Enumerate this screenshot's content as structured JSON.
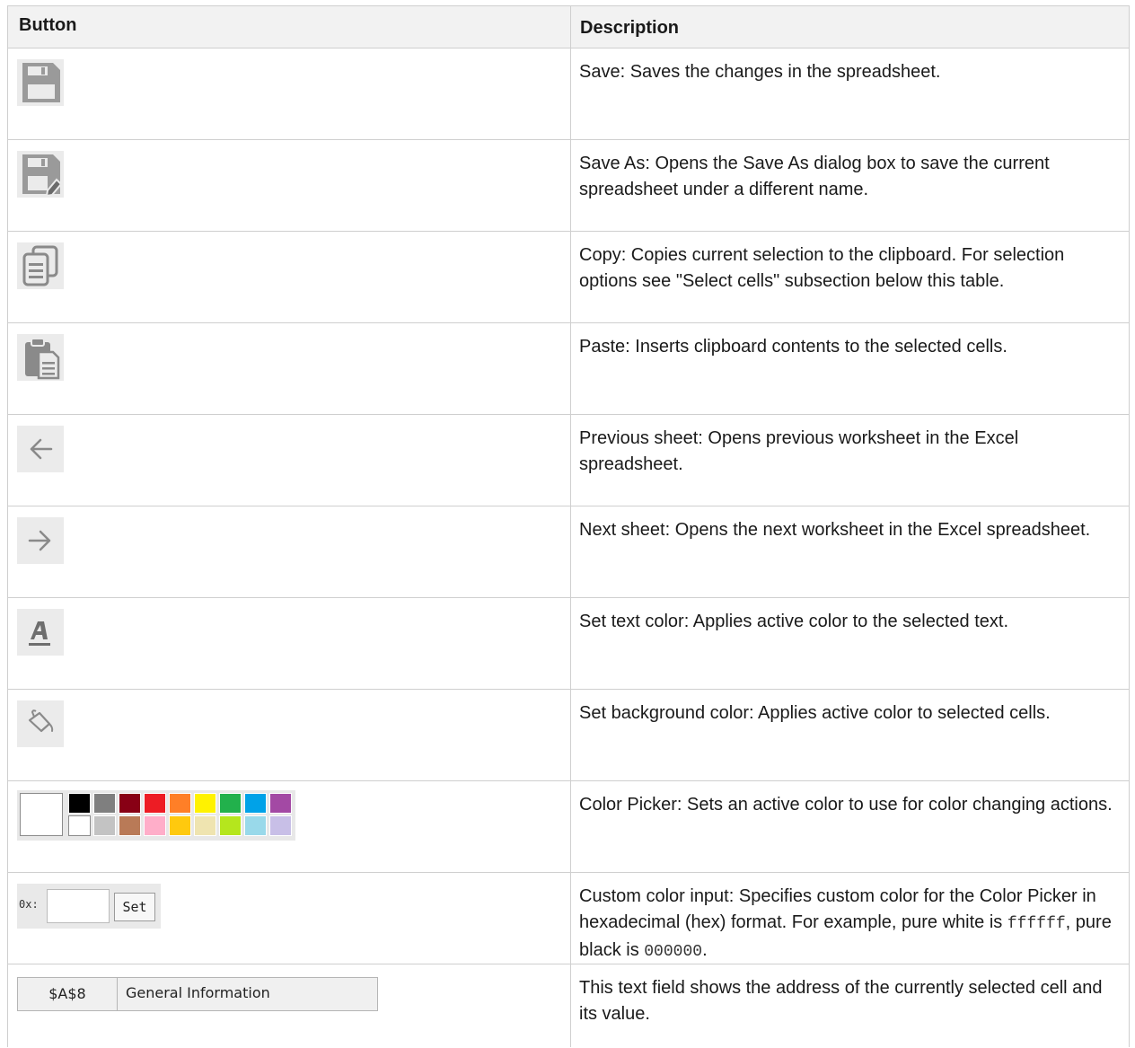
{
  "header": {
    "button": "Button",
    "description": "Description"
  },
  "rows": [
    {
      "icon": "save-icon",
      "text": "Save: Saves the changes in the spreadsheet."
    },
    {
      "icon": "save-as-icon",
      "text": "Save As: Opens the Save As dialog box to save the current spreadsheet under a different name."
    },
    {
      "icon": "copy-icon",
      "text": "Copy: Copies current selection to the clipboard. For selection options see \"Select cells\" subsection below this table."
    },
    {
      "icon": "paste-icon",
      "text": "Paste: Inserts clipboard contents to the selected cells."
    },
    {
      "icon": "arrow-left-icon",
      "text": "Previous sheet: Opens previous worksheet in the Excel spreadsheet."
    },
    {
      "icon": "arrow-right-icon",
      "text": "Next sheet: Opens the next worksheet in the Excel spreadsheet."
    },
    {
      "icon": "text-color-icon",
      "text": "Set text color: Applies active color to the selected text."
    },
    {
      "icon": "paint-bucket-icon",
      "text": "Set background color: Applies active color to selected cells."
    },
    {
      "icon": "color-picker",
      "text": "Color Picker: Sets an active color to use for color changing actions."
    }
  ],
  "custom_color_row": {
    "label": "0x:",
    "button": "Set",
    "text_before": "Custom color input: Specifies custom color for the Color Picker in hexadecimal (hex) format. For example, pure white is ",
    "code_white": "ffffff",
    "text_middle": ", pure black is ",
    "code_black": "000000",
    "text_after": "."
  },
  "address_row": {
    "address": "$A$8",
    "value": "General Information",
    "text": "This text field shows the address of the currently selected cell and its value."
  },
  "palette": {
    "top": [
      "#000000",
      "#7f7f7f",
      "#880015",
      "#ed1c24",
      "#ff7f27",
      "#fff200",
      "#22b14c",
      "#00a2e8",
      "#a349a4"
    ],
    "bottom": [
      "#ffffff",
      "#c3c3c3",
      "#b97a57",
      "#ffaec9",
      "#ffc90e",
      "#efe4b0",
      "#b5e61d",
      "#99d9ea",
      "#c8bfe7"
    ]
  }
}
